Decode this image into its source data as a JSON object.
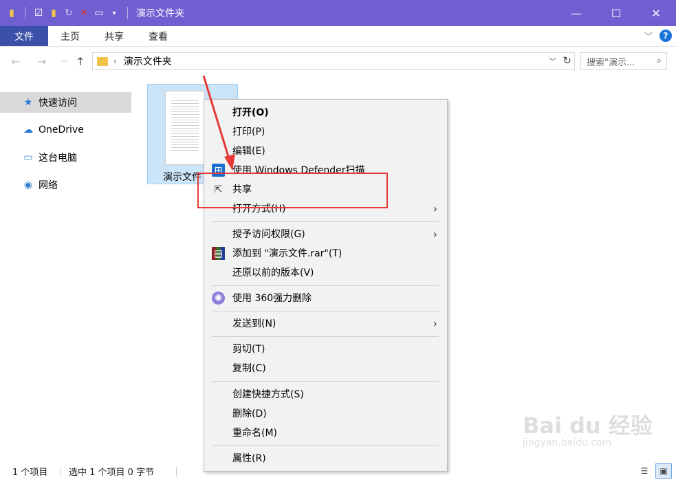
{
  "window": {
    "title": "演示文件夹"
  },
  "qat_icons": [
    "folder-icon",
    "properties-icon",
    "new-folder-icon",
    "undo-icon",
    "delete-icon",
    "rename-icon",
    "customize-dropdown-icon"
  ],
  "ribbon": {
    "file": "文件",
    "tabs": [
      "主页",
      "共享",
      "查看"
    ]
  },
  "address": {
    "path": "演示文件夹",
    "search_placeholder": "搜索\"演示..."
  },
  "sidebar": {
    "items": [
      {
        "label": "快速访问",
        "icon": "star-icon",
        "active": true
      },
      {
        "label": "OneDrive",
        "icon": "cloud-icon",
        "active": false
      },
      {
        "label": "这台电脑",
        "icon": "computer-icon",
        "active": false
      },
      {
        "label": "网络",
        "icon": "network-icon",
        "active": false
      }
    ]
  },
  "file": {
    "name": "演示文件"
  },
  "context_menu": {
    "open": "打开(O)",
    "print": "打印(P)",
    "edit": "编辑(E)",
    "defender": "使用 Windows Defender扫描",
    "share": "共享",
    "open_with": "打开方式(H)",
    "grant_access": "授予访问权限(G)",
    "add_rar": "添加到 \"演示文件.rar\"(T)",
    "restore": "还原以前的版本(V)",
    "force_delete": "使用 360强力删除",
    "send_to": "发送到(N)",
    "cut": "剪切(T)",
    "copy": "复制(C)",
    "create_shortcut": "创建快捷方式(S)",
    "delete": "删除(D)",
    "rename": "重命名(M)",
    "properties": "属性(R)"
  },
  "status": {
    "count": "1 个项目",
    "selected": "选中 1 个项目  0 字节"
  },
  "watermark": {
    "brand": "Bai du 经验",
    "url": "jingyan.baidu.com"
  },
  "colors": {
    "titlebar": "#6f5fd1",
    "file_tab": "#3b50a8",
    "highlight": "#e53935",
    "selection": "#cce4f7"
  }
}
